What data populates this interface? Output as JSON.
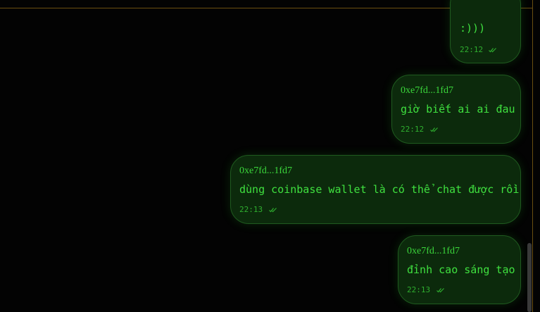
{
  "messages": [
    {
      "sender": "",
      "text": ":)))",
      "time": "22:12",
      "status": "read"
    },
    {
      "sender": "0xe7fd...1fd7",
      "text": "giờ biết ai ai đau",
      "time": "22:12",
      "status": "read"
    },
    {
      "sender": "0xe7fd...1fd7",
      "text": "dùng coinbase wallet là có thể chat được rồi",
      "time": "22:13",
      "status": "read"
    },
    {
      "sender": "0xe7fd...1fd7",
      "text": "đỉnh cao sáng tạo",
      "time": "22:13",
      "status": "read"
    }
  ],
  "icons": {
    "read_receipt": "double-check-icon"
  },
  "colors": {
    "bubble_bg": "#0c2a0c",
    "bubble_border": "#1f5a1f",
    "text": "#3fe03f",
    "accent_border": "#6a4f10"
  }
}
